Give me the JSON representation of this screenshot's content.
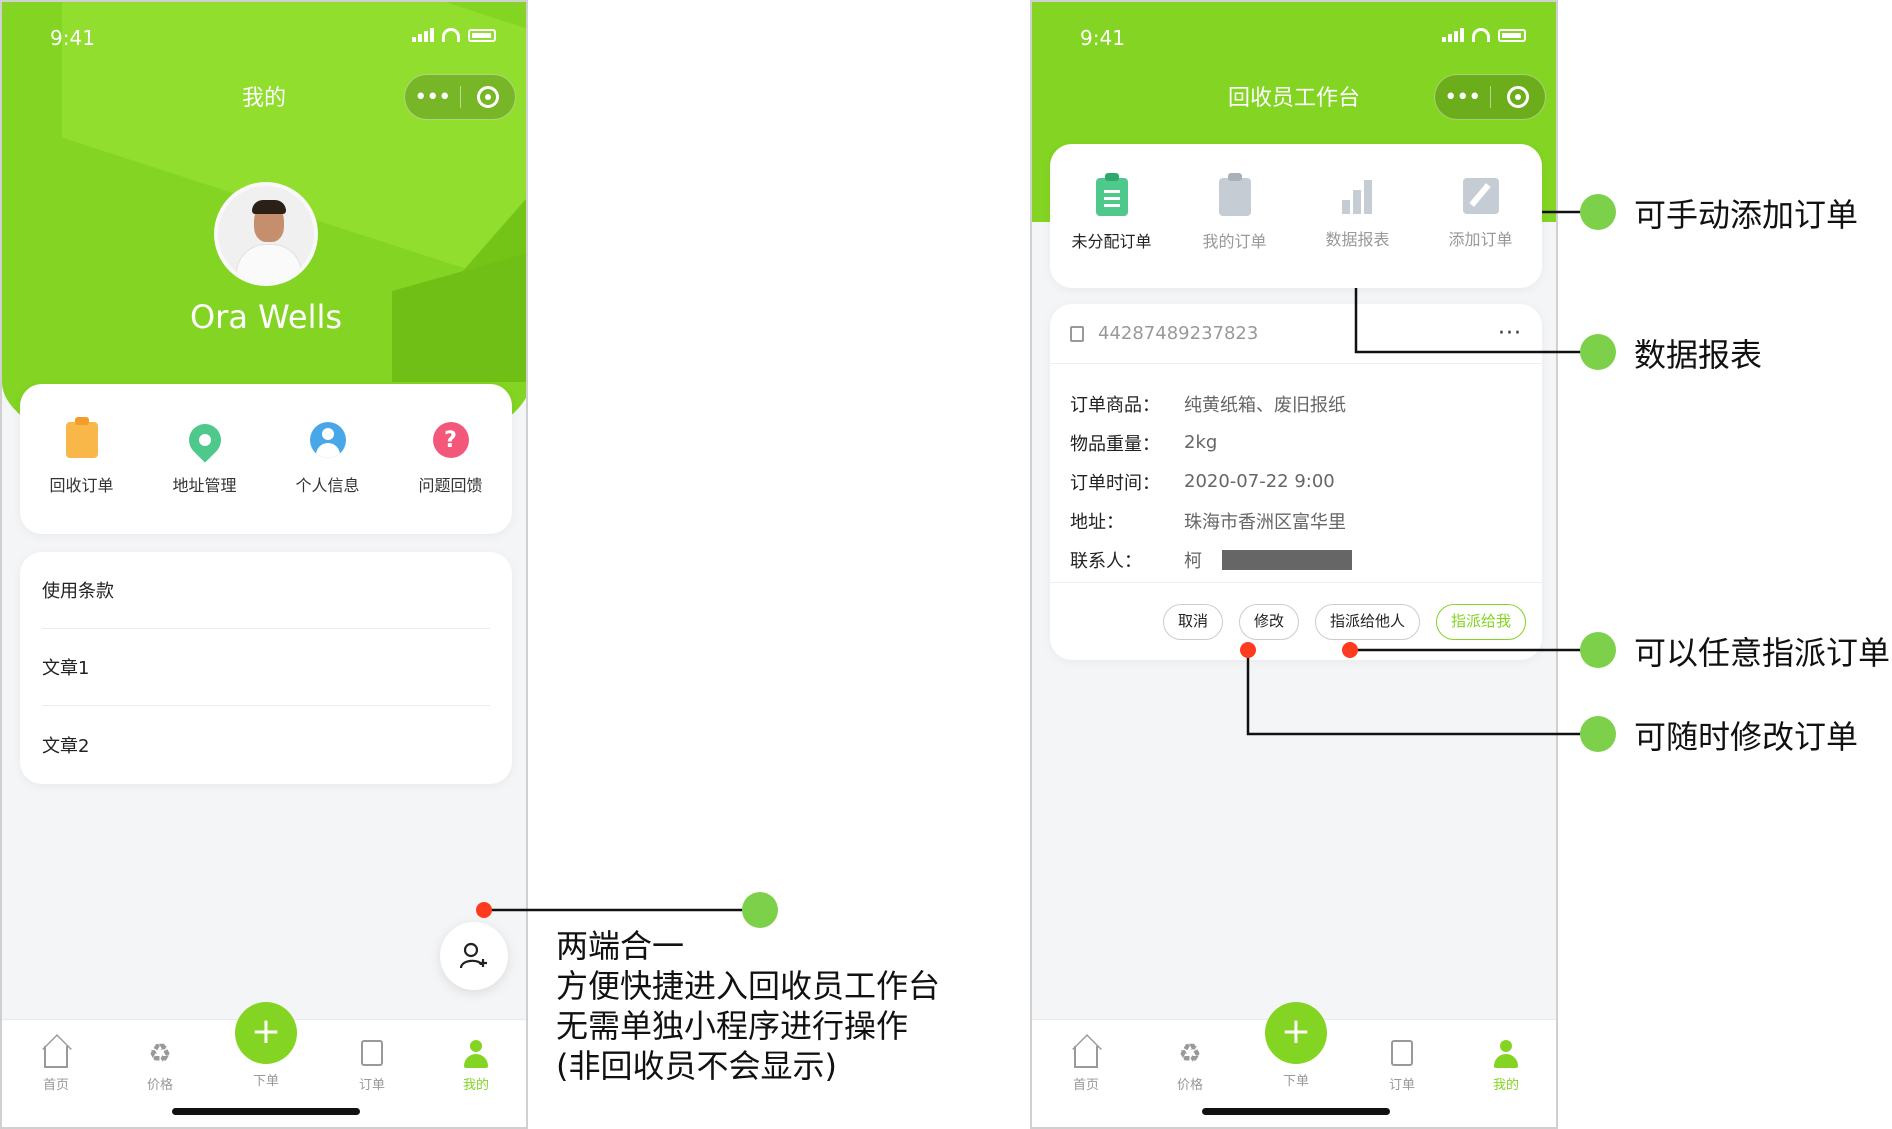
{
  "left_phone": {
    "status": {
      "time": "9:41"
    },
    "nav": {
      "title": "我的",
      "capsule_more": "•••"
    },
    "profile": {
      "name": "Ora Wells"
    },
    "quick_actions": [
      {
        "label": "回收订单",
        "icon": "clipboard-icon",
        "color": "#f9b74a"
      },
      {
        "label": "地址管理",
        "icon": "location-pin-icon",
        "color": "#4fc88b"
      },
      {
        "label": "个人信息",
        "icon": "user-circle-icon",
        "color": "#48a7e8"
      },
      {
        "label": "问题回馈",
        "icon": "question-icon",
        "color": "#f3587a"
      }
    ],
    "menu": [
      {
        "label": "使用条款"
      },
      {
        "label": "文章1"
      },
      {
        "label": "文章2"
      }
    ],
    "tabbar": {
      "tabs": [
        {
          "label": "首页",
          "icon": "home-icon"
        },
        {
          "label": "价格",
          "icon": "recycle-icon"
        },
        {
          "label": "下单",
          "icon": "plus-icon"
        },
        {
          "label": "订单",
          "icon": "order-icon"
        },
        {
          "label": "我的",
          "icon": "user-icon",
          "active": true
        }
      ],
      "center_symbol": "+"
    }
  },
  "right_phone": {
    "status": {
      "time": "9:41"
    },
    "nav": {
      "title": "回收员工作台",
      "capsule_more": "•••"
    },
    "work_actions": [
      {
        "label": "未分配订单",
        "icon": "clipboard-icon",
        "active": true
      },
      {
        "label": "我的订单",
        "icon": "clipboard-icon"
      },
      {
        "label": "数据报表",
        "icon": "bar-chart-icon"
      },
      {
        "label": "添加订单",
        "icon": "edit-icon"
      }
    ],
    "order": {
      "number": "44287489237823",
      "more": "···",
      "fields": [
        {
          "key": "订单商品：",
          "value": "纯黄纸箱、废旧报纸"
        },
        {
          "key": "物品重量：",
          "value": "2kg"
        },
        {
          "key": "订单时间：",
          "value": "2020-07-22 9:00"
        },
        {
          "key": "地址：",
          "value": "珠海市香洲区富华里"
        },
        {
          "key": "联系人：",
          "value": "柯"
        }
      ],
      "actions": [
        {
          "label": "取消"
        },
        {
          "label": "修改"
        },
        {
          "label": "指派给他人"
        },
        {
          "label": "指派给我",
          "primary": true
        }
      ]
    },
    "tabbar": {
      "tabs": [
        {
          "label": "首页",
          "icon": "home-icon"
        },
        {
          "label": "价格",
          "icon": "recycle-icon"
        },
        {
          "label": "下单",
          "icon": "plus-icon"
        },
        {
          "label": "订单",
          "icon": "order-icon"
        },
        {
          "label": "我的",
          "icon": "user-icon",
          "active": true
        }
      ],
      "center_symbol": "+"
    }
  },
  "annotations": {
    "left_multiline": [
      "两端合一",
      "方便快捷进入回收员工作台",
      "无需单独小程序进行操作",
      "(非回收员不会显示)"
    ],
    "add_order": "可手动添加订单",
    "data_report": "数据报表",
    "assign_order": "可以任意指派订单",
    "modify_order": "可随时修改订单"
  },
  "colors": {
    "brand_green": "#84d423",
    "marker_red": "#ff3b1f",
    "marker_green": "#7dd04a"
  }
}
